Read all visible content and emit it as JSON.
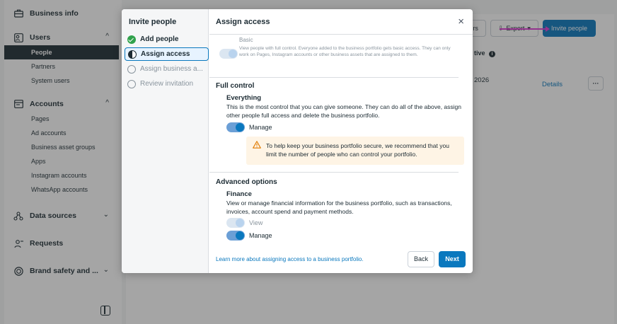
{
  "sidebar": {
    "business_info": "Business info",
    "users": "Users",
    "users_items": [
      "People",
      "Partners",
      "System users"
    ],
    "accounts": "Accounts",
    "accounts_items": [
      "Pages",
      "Ad accounts",
      "Business asset groups",
      "Apps",
      "Instagram accounts",
      "WhatsApp accounts"
    ],
    "data_sources": "Data sources",
    "requests": "Requests",
    "brand_safety": "Brand safety and ...",
    "chevron_up": "^",
    "chevron_down": "⌄"
  },
  "background": {
    "filter_label": "rs",
    "export_label": "Export",
    "invite_label": "Invite people",
    "col_active": "tive",
    "row_date": "2026",
    "details": "Details",
    "more": "···"
  },
  "modal": {
    "steps_title": "Invite people",
    "steps": [
      {
        "label": "Add people",
        "state": "done"
      },
      {
        "label": "Assign access",
        "state": "current"
      },
      {
        "label": "Assign business a...",
        "state": "todo"
      },
      {
        "label": "Review invitation",
        "state": "todo"
      }
    ],
    "title": "Assign access",
    "close": "×",
    "basic": {
      "title": "Basic",
      "desc": "View people with full control. Everyone added to the business portfolio gets basic access. They can only work on Pages, Instagram accounts or other business assets that are assigned to them."
    },
    "full_control": {
      "section": "Full control",
      "title": "Everything",
      "desc": "This is the most control that you can give someone. They can do all of the above, assign other people full access and delete the business portfolio.",
      "toggle_label": "Manage",
      "warning": "To help keep your business portfolio secure, we recommend that you limit the number of people who can control your portfolio."
    },
    "advanced": {
      "section": "Advanced options",
      "title": "Finance",
      "desc": "View or manage financial information for the business portfolio, such as transactions, invoices, account spend and payment methods.",
      "view_label": "View",
      "manage_label": "Manage"
    },
    "footer": {
      "learn_more": "Learn more about assigning access to a business portfolio.",
      "back": "Back",
      "next": "Next"
    }
  },
  "colors": {
    "accent": "#0a78be",
    "done": "#31a24c",
    "warning_bg": "#fef4e5",
    "warning_icon": "#e07a00",
    "annotation": "#e03ad6"
  }
}
